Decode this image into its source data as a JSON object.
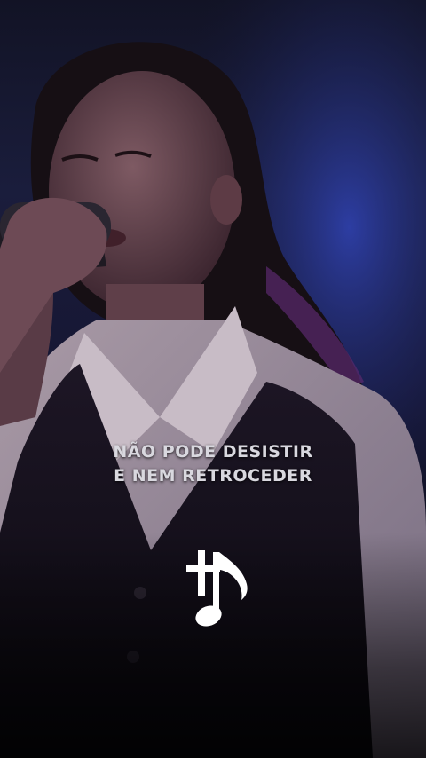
{
  "video": {
    "lyrics": {
      "line1": "NÃO PODE DESISTIR",
      "line2": "E NEM RETROCEDER"
    },
    "watermark_icon": "cross-music-note-icon",
    "colors": {
      "caption": "#d9d8df",
      "stage_light": "#2b3a9a",
      "accent_purple": "#6a2d8f"
    }
  }
}
